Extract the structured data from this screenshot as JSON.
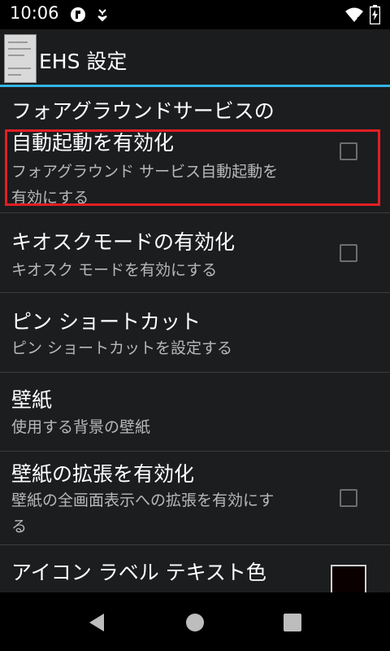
{
  "status_bar": {
    "time": "10:06",
    "icons": [
      "app-notification-icon",
      "download-icon",
      "wifi-icon",
      "battery-charging-icon"
    ]
  },
  "action_bar": {
    "title": "EHS 設定",
    "icon": "app-thumbnail-icon"
  },
  "settings": {
    "items": [
      {
        "title": "フォアグラウンドサービスの\n自動起動を有効化",
        "subtitle": "フォアグラウンド サービス自動起動を\n有効にする",
        "control": "checkbox",
        "checked": false
      },
      {
        "title": "キオスクモードの有効化",
        "subtitle": "キオスク モードを有効にする",
        "control": "checkbox",
        "checked": false,
        "highlighted": true
      },
      {
        "title": "ピン ショートカット",
        "subtitle": "ピン ショートカットを設定する"
      },
      {
        "title": "壁紙",
        "subtitle": "使用する背景の壁紙"
      },
      {
        "title": "壁紙の拡張を有効化",
        "subtitle": "壁紙の全画面表示への拡張を有効にす\nる",
        "control": "checkbox",
        "checked": false
      },
      {
        "title": "アイコン ラベル テキスト色",
        "control": "color-swatch",
        "swatch_color": "#0a0000"
      }
    ]
  },
  "colors": {
    "accent": "#33b5e5",
    "highlight": "#e31e24"
  },
  "nav_bar": {
    "icons": [
      "back-icon",
      "home-icon",
      "recents-icon"
    ]
  }
}
